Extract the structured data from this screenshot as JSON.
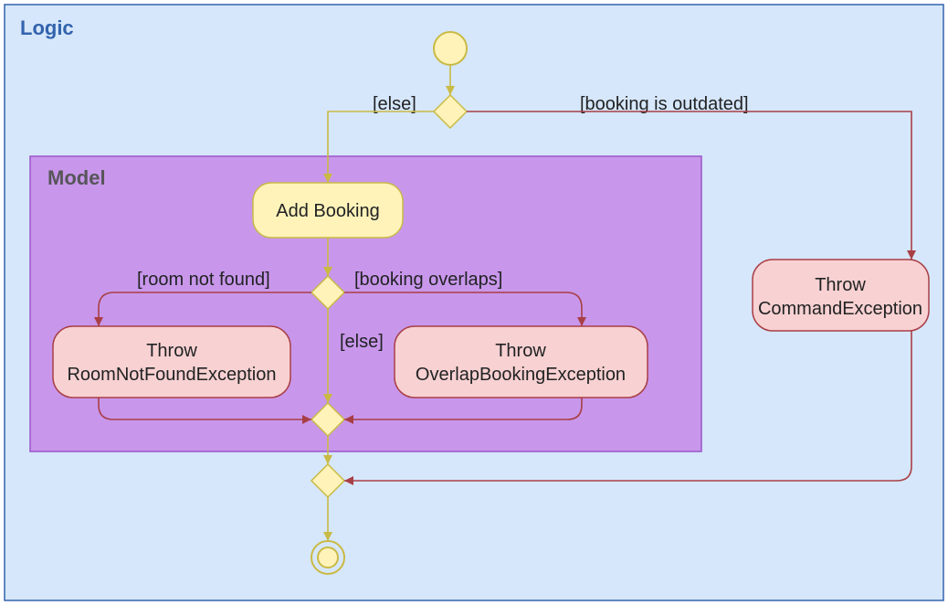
{
  "regions": {
    "logic": "Logic",
    "model": "Model"
  },
  "nodes": {
    "addBooking": "Add Booking",
    "throwRoomNotFound_l1": "Throw",
    "throwRoomNotFound_l2": "RoomNotFoundException",
    "throwOverlap_l1": "Throw",
    "throwOverlap_l2": "OverlapBookingException",
    "throwCommand_l1": "Throw",
    "throwCommand_l2": "CommandException"
  },
  "guards": {
    "else_top": "[else]",
    "booking_outdated": "[booking is outdated]",
    "room_not_found": "[room not found]",
    "booking_overlaps": "[booking overlaps]",
    "else_mid": "[else]"
  }
}
